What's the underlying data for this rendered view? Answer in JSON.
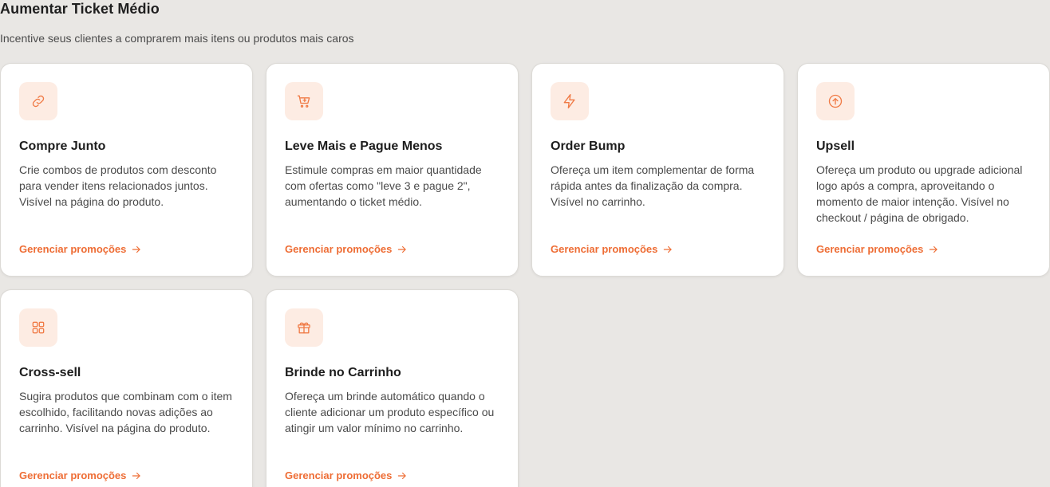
{
  "header": {
    "title": "Aumentar Ticket Médio",
    "subtitle": "Incentive seus clientes a comprarem mais itens ou produtos mais caros"
  },
  "accent_color": "#f07a45",
  "icon_bg_color": "#fdece3",
  "cards": [
    {
      "icon": "link-icon",
      "title": "Compre Junto",
      "description": "Crie combos de produtos com desconto para vender itens relacionados juntos. Visível na página do produto.",
      "link": "Gerenciar promoções"
    },
    {
      "icon": "cart-plus-icon",
      "title": "Leve Mais e Pague Menos",
      "description": "Estimule compras em maior quantidade com ofertas como \"leve 3 e pague 2\", aumentando o ticket médio.",
      "link": "Gerenciar promoções"
    },
    {
      "icon": "lightning-icon",
      "title": "Order Bump",
      "description": "Ofereça um item complementar de forma rápida antes da finalização da compra. Visível no carrinho.",
      "link": "Gerenciar promoções"
    },
    {
      "icon": "arrow-up-circle-icon",
      "title": "Upsell",
      "description": "Ofereça um produto ou upgrade adicional logo após a compra, aproveitando o momento de maior intenção. Visível no checkout / página de obrigado.",
      "link": "Gerenciar promoções"
    },
    {
      "icon": "grid-icon",
      "title": "Cross-sell",
      "description": "Sugira produtos que combinam com o item escolhido, facilitando novas adições ao carrinho. Visível na página do produto.",
      "link": "Gerenciar promoções"
    },
    {
      "icon": "gift-icon",
      "title": "Brinde no Carrinho",
      "description": "Ofereça um brinde automático quando o cliente adicionar um produto específico ou atingir um valor mínimo no carrinho.",
      "link": "Gerenciar promoções"
    }
  ]
}
